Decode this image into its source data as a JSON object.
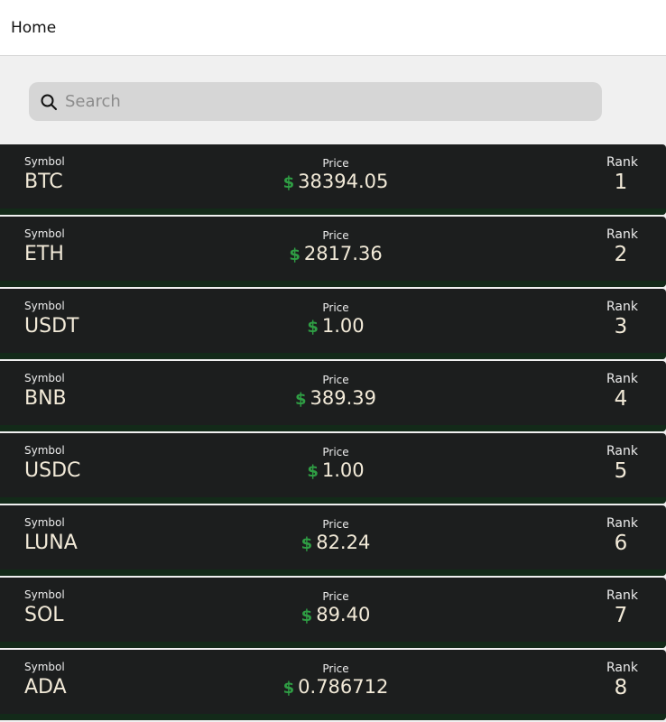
{
  "header": {
    "title": "Home"
  },
  "search": {
    "placeholder": "Search",
    "value": ""
  },
  "currency_symbol": "$",
  "labels": {
    "symbol": "Symbol",
    "price": "Price",
    "rank": "Rank"
  },
  "colors": {
    "card_background": "#1c1e1e",
    "card_accent": "#132a19",
    "dollar_sign": "#2f9e44",
    "value_text": "#f2ead8"
  },
  "coins": [
    {
      "symbol": "BTC",
      "price": "38394.05",
      "rank": "1"
    },
    {
      "symbol": "ETH",
      "price": "2817.36",
      "rank": "2"
    },
    {
      "symbol": "USDT",
      "price": "1.00",
      "rank": "3"
    },
    {
      "symbol": "BNB",
      "price": "389.39",
      "rank": "4"
    },
    {
      "symbol": "USDC",
      "price": "1.00",
      "rank": "5"
    },
    {
      "symbol": "LUNA",
      "price": "82.24",
      "rank": "6"
    },
    {
      "symbol": "SOL",
      "price": "89.40",
      "rank": "7"
    },
    {
      "symbol": "ADA",
      "price": "0.786712",
      "rank": "8"
    }
  ]
}
